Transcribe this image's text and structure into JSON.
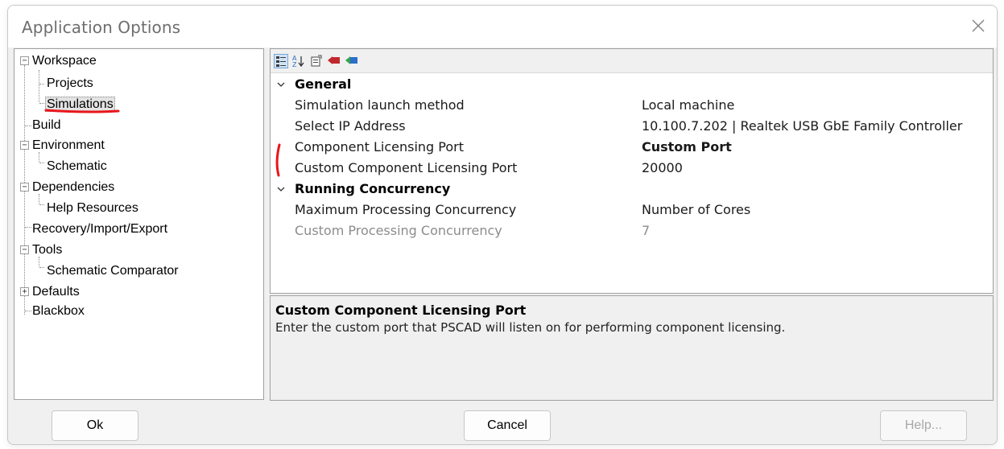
{
  "window": {
    "title": "Application Options"
  },
  "tree": {
    "items": [
      {
        "label": "Workspace",
        "expander": "−"
      },
      {
        "label": "Projects"
      },
      {
        "label": "Simulations"
      },
      {
        "label": "Build"
      },
      {
        "label": "Environment",
        "expander": "−"
      },
      {
        "label": "Schematic"
      },
      {
        "label": "Dependencies",
        "expander": "−"
      },
      {
        "label": "Help Resources"
      },
      {
        "label": "Recovery/Import/Export"
      },
      {
        "label": "Tools",
        "expander": "−"
      },
      {
        "label": "Schematic Comparator"
      },
      {
        "label": "Defaults",
        "expander": "+"
      },
      {
        "label": "Blackbox"
      }
    ],
    "selected": "Simulations"
  },
  "toolbar": {
    "icons": [
      "categorized-icon",
      "alphabetical-sort-icon",
      "property-pages-icon",
      "red-arrow-icon",
      "green-arrow-icon"
    ]
  },
  "properties": {
    "categories": [
      {
        "name": "General",
        "rows": [
          {
            "name": "Simulation launch method",
            "value": "Local machine"
          },
          {
            "name": "Select IP Address",
            "value": "10.100.7.202 | Realtek USB GbE Family Controller"
          },
          {
            "name": "Component Licensing Port",
            "value": "Custom Port"
          },
          {
            "name": "Custom Component Licensing Port",
            "value": "20000"
          }
        ]
      },
      {
        "name": "Running Concurrency",
        "rows": [
          {
            "name": "Maximum Processing Concurrency",
            "value": "Number of Cores"
          },
          {
            "name": "Custom Processing Concurrency",
            "value": "7"
          }
        ]
      }
    ]
  },
  "description": {
    "title": "Custom Component Licensing Port",
    "text": "Enter the custom port that PSCAD will listen on for performing component licensing."
  },
  "buttons": {
    "ok": "Ok",
    "cancel": "Cancel",
    "help": "Help..."
  },
  "colors": {
    "annotation": "#e8161b",
    "accent_blue": "#2b6fc8"
  }
}
